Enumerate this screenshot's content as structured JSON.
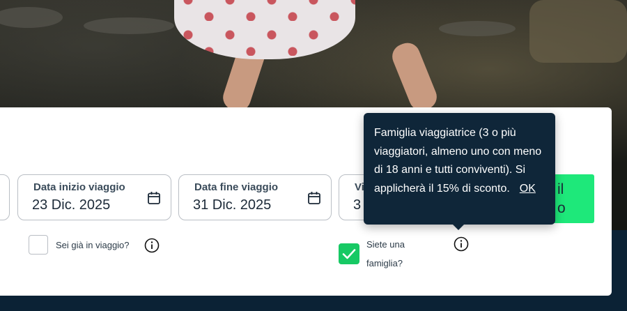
{
  "fields": {
    "start_date": {
      "label": "Data inizio viaggio",
      "value": "23 Dic. 2025"
    },
    "end_date": {
      "label": "Data fine viaggio",
      "value": "31 Dic. 2025"
    },
    "partial": {
      "label": "Vi",
      "value": "3"
    }
  },
  "cta": {
    "line1": "il",
    "line2": "o"
  },
  "already_travelling": {
    "label": "Sei già in viaggio?",
    "checked": false
  },
  "family": {
    "label_line1": "Siete una",
    "label_line2": "famiglia?",
    "checked": true
  },
  "tooltip": {
    "text": "Famiglia viaggiatrice (3 o più viaggiatori, almeno uno con meno di 18 anni e tutti conviventi). Si applicherà il 15% di sconto.",
    "ok_label": "OK"
  },
  "colors": {
    "accent": "#1ee87a",
    "navy": "#0f2639",
    "check_green": "#17c964"
  },
  "icons": [
    "calendar-icon",
    "info-icon",
    "checkmark-icon"
  ]
}
